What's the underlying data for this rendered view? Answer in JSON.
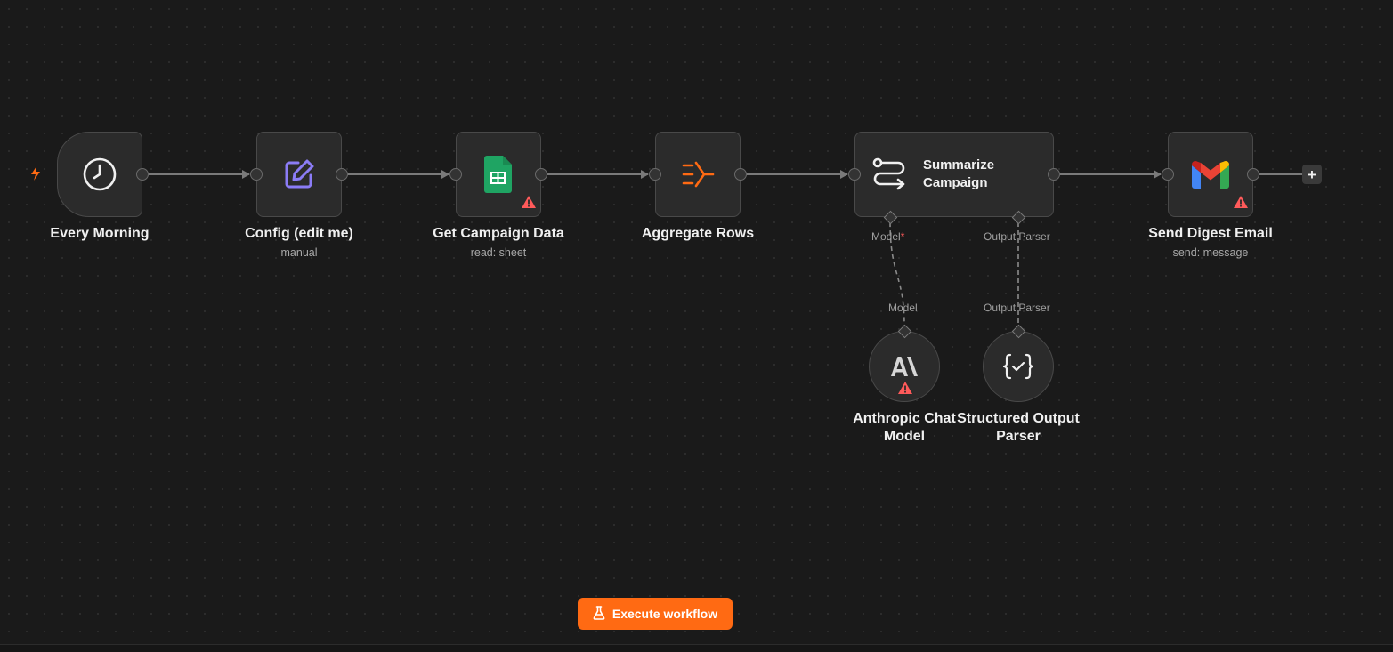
{
  "nodes": {
    "every_morning": {
      "label": "Every Morning",
      "subtitle": "",
      "icon": "clock-icon"
    },
    "config": {
      "label": "Config (edit me)",
      "subtitle": "manual",
      "icon": "edit-icon"
    },
    "get_campaign": {
      "label": "Get Campaign Data",
      "subtitle": "read: sheet",
      "icon": "google-sheets-icon",
      "warning": true
    },
    "aggregate": {
      "label": "Aggregate Rows",
      "subtitle": "",
      "icon": "aggregate-icon"
    },
    "summarize": {
      "label": "Summarize Campaign",
      "icon": "ai-agent-icon"
    },
    "send_email": {
      "label": "Send Digest Email",
      "subtitle": "send: message",
      "icon": "gmail-icon",
      "warning": true
    },
    "anthropic": {
      "label": "Anthropic Chat Model",
      "icon": "anthropic-icon",
      "warning": true
    },
    "parser": {
      "label": "Structured Output Parser",
      "icon": "json-check-icon"
    }
  },
  "ports": {
    "model_top": "Model",
    "model_required": "*",
    "parser_top": "Output Parser",
    "model_bottom": "Model",
    "parser_bottom": "Output Parser"
  },
  "toolbar": {
    "add_node": "+",
    "execute_label": "Execute workflow"
  },
  "colors": {
    "accent": "#ff6a13",
    "warning": "#ff5a5a",
    "config_icon": "#8b7cf6",
    "sheets": "#1fa463",
    "aggregate_icon": "#ff6a13"
  }
}
